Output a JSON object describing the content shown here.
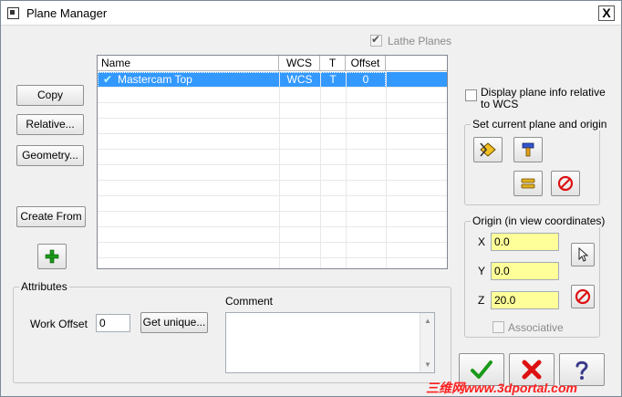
{
  "window": {
    "title": "Plane Manager",
    "close_label": "X"
  },
  "lathe_planes": {
    "label": "Lathe Planes",
    "checked": true
  },
  "buttons": {
    "copy": "Copy",
    "relative": "Relative...",
    "geometry": "Geometry...",
    "create_from": "Create From",
    "get_unique": "Get unique..."
  },
  "grid": {
    "columns": [
      "Name",
      "WCS",
      "T",
      "Offset"
    ],
    "rows": [
      {
        "name": "Mastercam Top",
        "wcs": "WCS",
        "t": "T",
        "offset": "0"
      }
    ]
  },
  "display_info": {
    "line1": "Display plane info relative",
    "line2": "to WCS",
    "checked": false
  },
  "set_current": {
    "title": "Set current plane and origin"
  },
  "origin": {
    "title": "Origin (in view coordinates)",
    "x_label": "X",
    "x_value": "0.0",
    "y_label": "Y",
    "y_value": "0.0",
    "z_label": "Z",
    "z_value": "20.0",
    "associative_label": "Associative"
  },
  "attributes": {
    "title": "Attributes",
    "work_offset_label": "Work Offset",
    "work_offset_value": "0",
    "comment_label": "Comment"
  },
  "watermark": "三维网www.3dportal.com",
  "colors": {
    "selection": "#3399ff",
    "origin_field": "#ffff99",
    "ok_green": "#1a9a1a",
    "cancel_red": "#dd1111"
  }
}
